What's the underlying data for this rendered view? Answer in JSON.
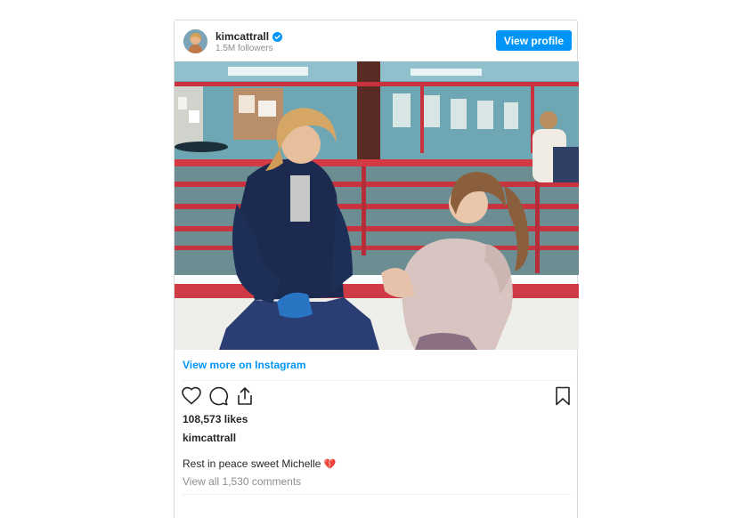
{
  "post": {
    "username": "kimcattrall",
    "followers": "1.5M followers",
    "view_profile_label": "View profile",
    "view_more_label": "View more on Instagram",
    "likes": "108,573 likes",
    "caption_username": "kimcattrall",
    "caption_text": "Rest in peace sweet Michelle",
    "caption_emoji": "💔",
    "comments_label": "View all 1,530 comments"
  },
  "icons": {
    "verified": "verified-badge-icon",
    "like": "heart-icon",
    "comment": "comment-icon",
    "share": "share-icon",
    "save": "bookmark-icon"
  },
  "colors": {
    "accent": "#0095f6",
    "text": "#262626",
    "muted": "#8e8e8e",
    "border": "#dbdbdb"
  }
}
